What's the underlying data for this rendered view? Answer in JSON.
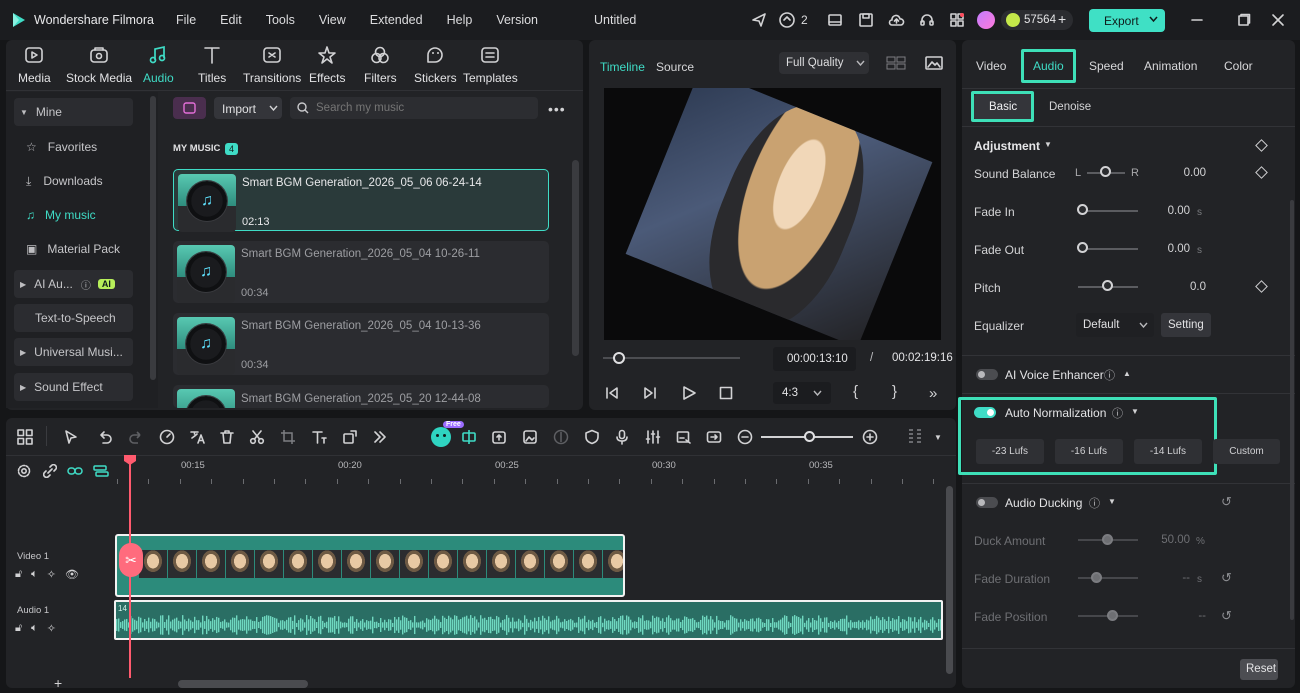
{
  "app": {
    "name": "Wondershare Filmora",
    "project_title": "Untitled"
  },
  "menu": [
    "File",
    "Edit",
    "Tools",
    "View",
    "Extended",
    "Help",
    "Version"
  ],
  "titlebar": {
    "notification_count": "2",
    "credits": "57564",
    "export_label": "Export"
  },
  "toolbar": [
    "Media",
    "Stock Media",
    "Audio",
    "Titles",
    "Transitions",
    "Effects",
    "Filters",
    "Stickers",
    "Templates"
  ],
  "sidebar": {
    "items": [
      "Mine",
      "Favorites",
      "Downloads",
      "My music",
      "Material Pack",
      "AI Au...",
      "Text-to-Speech",
      "Universal Musi...",
      "Sound Effect"
    ],
    "ai_badge": "AI"
  },
  "library": {
    "import_label": "Import",
    "search_placeholder": "Search my music",
    "section_title": "MY MUSIC",
    "count": "4",
    "tracks": [
      {
        "title": "Smart BGM Generation_2026_05_06 06-24-14",
        "duration": "02:13"
      },
      {
        "title": "Smart BGM Generation_2026_05_04 10-26-11",
        "duration": "00:34"
      },
      {
        "title": "Smart BGM Generation_2026_05_04 10-13-36",
        "duration": "00:34"
      },
      {
        "title": "Smart BGM Generation_2025_05_20 12-44-08",
        "duration": ""
      }
    ]
  },
  "preview": {
    "tabs": [
      "Timeline",
      "Source"
    ],
    "quality": "Full Quality",
    "current_time": "00:00:13:10",
    "separator": "/",
    "total_time": "00:02:19:16",
    "aspect": "4:3"
  },
  "inspector": {
    "tabs": [
      "Video",
      "Audio",
      "Speed",
      "Animation",
      "Color"
    ],
    "subtabs": [
      "Basic",
      "Denoise"
    ],
    "adjustment_title": "Adjustment",
    "rows": [
      {
        "label": "Sound Balance",
        "value": "0.00",
        "left": "L",
        "right": "R"
      },
      {
        "label": "Fade In",
        "value": "0.00",
        "unit": "s"
      },
      {
        "label": "Fade Out",
        "value": "0.00",
        "unit": "s"
      },
      {
        "label": "Pitch",
        "value": "0.0"
      }
    ],
    "equalizer_label": "Equalizer",
    "equalizer_value": "Default",
    "setting_label": "Setting",
    "ai_voice_label": "AI Voice Enhancer",
    "auto_norm_label": "Auto Normalization",
    "lufs_options": [
      "-23 Lufs",
      "-16 Lufs",
      "-14 Lufs",
      "Custom"
    ],
    "ducking_label": "Audio Ducking",
    "ducking_rows": [
      {
        "label": "Duck Amount",
        "value": "50.00",
        "unit": "%"
      },
      {
        "label": "Fade Duration",
        "value": "--",
        "unit": "s"
      },
      {
        "label": "Fade Position",
        "value": "--",
        "unit": ""
      }
    ],
    "reset_label": "Reset"
  },
  "timeline": {
    "ruler": [
      "00:15",
      "00:20",
      "00:25",
      "00:30",
      "00:35"
    ],
    "video_track": "Video 1",
    "audio_track": "Audio 1",
    "audio_clip_label": "14",
    "free_badge": "Free"
  },
  "colors": {
    "accent": "#3fdcc6",
    "export": "#3fe0c5",
    "highlight": "#3ee0b8",
    "playhead": "#ff5a6e"
  }
}
